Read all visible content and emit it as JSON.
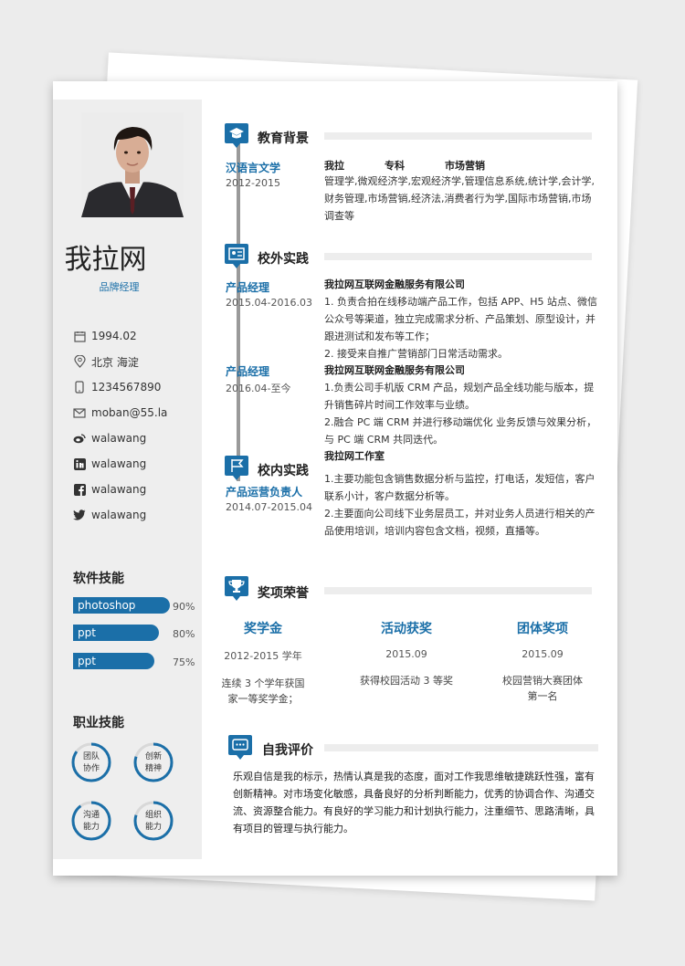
{
  "profile": {
    "name": "我拉网",
    "position": "品牌经理",
    "info": [
      {
        "icon": "calendar-icon",
        "text": "1994.02"
      },
      {
        "icon": "location-icon",
        "text": "北京  海淀"
      },
      {
        "icon": "phone-icon",
        "text": "1234567890"
      },
      {
        "icon": "email-icon",
        "text": "moban@55.la"
      },
      {
        "icon": "weibo-icon",
        "text": "walawang"
      },
      {
        "icon": "linkedin-icon",
        "text": "walawang"
      },
      {
        "icon": "facebook-icon",
        "text": "walawang"
      },
      {
        "icon": "twitter-icon",
        "text": "walawang"
      }
    ]
  },
  "software_skills": {
    "title": "软件技能",
    "items": [
      {
        "name": "photoshop",
        "pct": "90%",
        "level": 0.9
      },
      {
        "name": "ppt",
        "pct": "80%",
        "level": 0.8
      },
      {
        "name": "ppt",
        "pct": "75%",
        "level": 0.75
      }
    ]
  },
  "pro_skills": {
    "title": "职业技能",
    "items": [
      {
        "line1": "团队",
        "line2": "协作",
        "level": 0.85
      },
      {
        "line1": "创新",
        "line2": "精神",
        "level": 0.8
      },
      {
        "line1": "沟通",
        "line2": "能力",
        "level": 0.9
      },
      {
        "line1": "组织",
        "line2": "能力",
        "level": 0.8
      }
    ]
  },
  "education": {
    "title": "教育背景",
    "major": "汉语言文学",
    "date": "2012-2015",
    "school": "我拉",
    "degree": "专科",
    "field": "市场营销",
    "courses": "管理学,微观经济学,宏观经济学,管理信息系统,统计学,会计学,财务管理,市场营销,经济法,消费者行为学,国际市场营销,市场调查等"
  },
  "external": {
    "title": "校外实践",
    "jobs": [
      {
        "role": "产品经理",
        "date": "2015.04-2016.03",
        "org": "我拉网互联网金融服务有限公司",
        "lines": [
          "1. 负责合拍在线移动端产品工作，包括 APP、H5 站点、微信公众号等渠道，独立完成需求分析、产品策划、原型设计，并跟进测试和发布等工作；",
          "2. 接受来自推广营销部门日常活动需求。"
        ]
      },
      {
        "role": "产品经理",
        "date": "2016.04-至今",
        "org": "我拉网互联网金融服务有限公司",
        "lines": [
          "1.负责公司手机版 CRM 产品，规划产品全线功能与版本，提升销售碎片时间工作效率与业绩。",
          "2.融合 PC 端 CRM 并进行移动端优化 业务反馈与效果分析，与 PC 端 CRM 共同迭代。"
        ]
      }
    ]
  },
  "internal": {
    "title": "校内实践",
    "role": "产品运营负责人",
    "date": "2014.07-2015.04",
    "org": "我拉网工作室",
    "lines": [
      "1.主要功能包含销售数据分析与监控，打电话，发短信，客户联系小计，客户数据分析等。",
      "2.主要面向公司线下业务层员工，并对业务人员进行相关的产品使用培训，培训内容包含文档，视频，直播等。"
    ]
  },
  "awards": {
    "title": "奖项荣誉",
    "items": [
      {
        "title": "奖学金",
        "date": "2012-2015 学年",
        "desc": "连续 3 个学年获国家一等奖学金；"
      },
      {
        "title": "活动获奖",
        "date": "2015.09",
        "desc": "获得校园活动 3 等奖"
      },
      {
        "title": "团体奖项",
        "date": "2015.09",
        "desc": "校园营销大赛团体第一名"
      }
    ]
  },
  "self_eval": {
    "title": "自我评价",
    "text": "乐观自信是我的标示，热情认真是我的态度，面对工作我思维敏捷跳跃性强，富有创新精神。对市场变化敏感，具备良好的分析判断能力，优秀的协调合作、沟通交流、资源整合能力。有良好的学习能力和计划执行能力，注重细节、思路清晰，具有项目的管理与执行能力。"
  },
  "colors": {
    "accent": "#1b6fa8",
    "timeline": "#9a9a9a",
    "sidebar": "#eeeeee"
  }
}
